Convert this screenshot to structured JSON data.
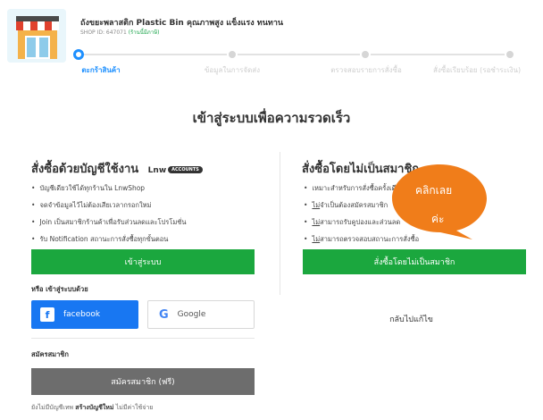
{
  "shop": {
    "name": "ถังขยะพลาสติก Plastic Bin คุณภาพสูง แข็งแรง ทนทาน",
    "id_text": "SHOP ID: 647071",
    "verified_text": "(ร้านนี้มีภาษี)",
    "logo_icon": "storefront-icon"
  },
  "steps": [
    {
      "label": "ตะกร้าสินค้า",
      "active": true
    },
    {
      "label": "ข้อมูลในการจัดส่ง",
      "active": false
    },
    {
      "label": "ตรวจสอบรายการสั่งซื้อ",
      "active": false
    },
    {
      "label": "สั่งซื้อเรียบร้อย (รอชำระเงิน)",
      "active": false
    }
  ],
  "page_title": "เข้าสู่ระบบเพื่อความรวดเร็ว",
  "member": {
    "title": "สั่งซื้อด้วยบัญชีใช้งาน",
    "badge_brand": "Lnw",
    "badge_text": "ACCOUNTS",
    "bullets": [
      "บัญชีเดียวใช้ได้ทุกร้านใน LnwShop",
      "จดจำข้อมูลไว้ไม่ต้องเสียเวลากรอกใหม่",
      "Join เป็นสมาชิกร้านค้าเพื่อรับส่วนลดและโปรโมชั่น",
      "รับ Notification สถานะการสั่งซื้อทุกขั้นตอน"
    ],
    "login_button": "เข้าสู่ระบบ",
    "social_label": "หรือ เข้าสู่ระบบด้วย",
    "facebook_button": "facebook",
    "google_button": "Google",
    "register_label": "สมัครสมาชิก",
    "register_button": "สมัครสมาชิก (ฟรี)",
    "footer_prefix": "ยังไม่มีบัญชีเทพ",
    "footer_link": "สร้างบัญชีใหม่",
    "footer_suffix": "ไม่มีค่าใช้จ่าย"
  },
  "guest": {
    "title": "สั่งซื้อโดยไม่เป็นสมาชิก",
    "bullets": [
      {
        "u": "",
        "text": "เหมาะสำหรับการสั่งซื้อครั้งเดียว"
      },
      {
        "u": "ไม่",
        "text": "จำเป็นต้องสมัครสมาชิก"
      },
      {
        "u": "ไม่",
        "text": "สามารถรับคูปองและส่วนลด"
      },
      {
        "u": "ไม่",
        "text": "สามารถตรวจสอบสถานะการสั่งซื้อ"
      }
    ],
    "order_button": "สั่งซื้อโดยไม่เป็นสมาชิก",
    "back_link": "กลับไปแก้ไข"
  },
  "callout": {
    "line1": "คลิกเลย",
    "line2": "ค่ะ",
    "color": "#f07d1a"
  },
  "colors": {
    "primary_green": "#1ba73e",
    "accent_blue": "#1e90ff",
    "facebook_blue": "#1877f2",
    "register_grey": "#6d6d6d"
  }
}
